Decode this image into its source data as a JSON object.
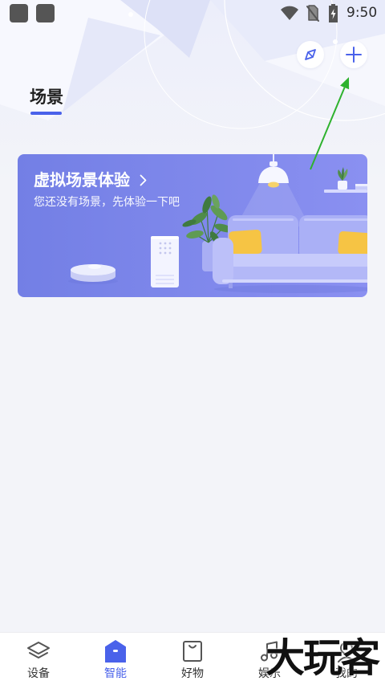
{
  "status_bar": {
    "time": "9:50",
    "left_icons": [
      "notification-icon",
      "notification-icon"
    ],
    "right_icons": [
      "wifi-icon",
      "no-sim-icon",
      "battery-charging-icon"
    ]
  },
  "header": {
    "title": "场景",
    "actions": [
      {
        "icon": "compass-icon"
      },
      {
        "icon": "plus-icon"
      }
    ]
  },
  "banner": {
    "title": "虚拟场景体验",
    "subtitle": "您还没有场景，先体验一下吧",
    "chevron_icon": "chevron-right-icon",
    "illustration_icons": [
      "pendant-lamp-icon",
      "wall-shelf-icon",
      "sofa-icon",
      "potted-plant-icon",
      "air-purifier-icon",
      "robot-vacuum-icon"
    ]
  },
  "tab_bar": {
    "tabs": [
      {
        "label": "设备",
        "icon": "layers-icon",
        "active": false
      },
      {
        "label": "智能",
        "icon": "smart-home-icon",
        "active": true
      },
      {
        "label": "好物",
        "icon": "shopping-bag-icon",
        "active": false
      },
      {
        "label": "娱乐",
        "icon": "music-note-icon",
        "active": false
      },
      {
        "label": "我的",
        "icon": "profile-icon",
        "active": false
      }
    ]
  },
  "annotation": {
    "icon": "arrow-icon"
  },
  "watermark": {
    "text": "大玩客"
  },
  "colors": {
    "accent": "#4a62ea",
    "text_primary": "#1f1f1f",
    "text_secondary": "#333333",
    "icon_gray": "#555555",
    "page_background": "#f3f4f9",
    "banner_start": "#737fe5",
    "banner_end": "#8a90f1",
    "cushion": "#f6c444",
    "plant": "#4f8c4a",
    "annotation_arrow": "#2eb22e",
    "watermark": "#111111"
  }
}
